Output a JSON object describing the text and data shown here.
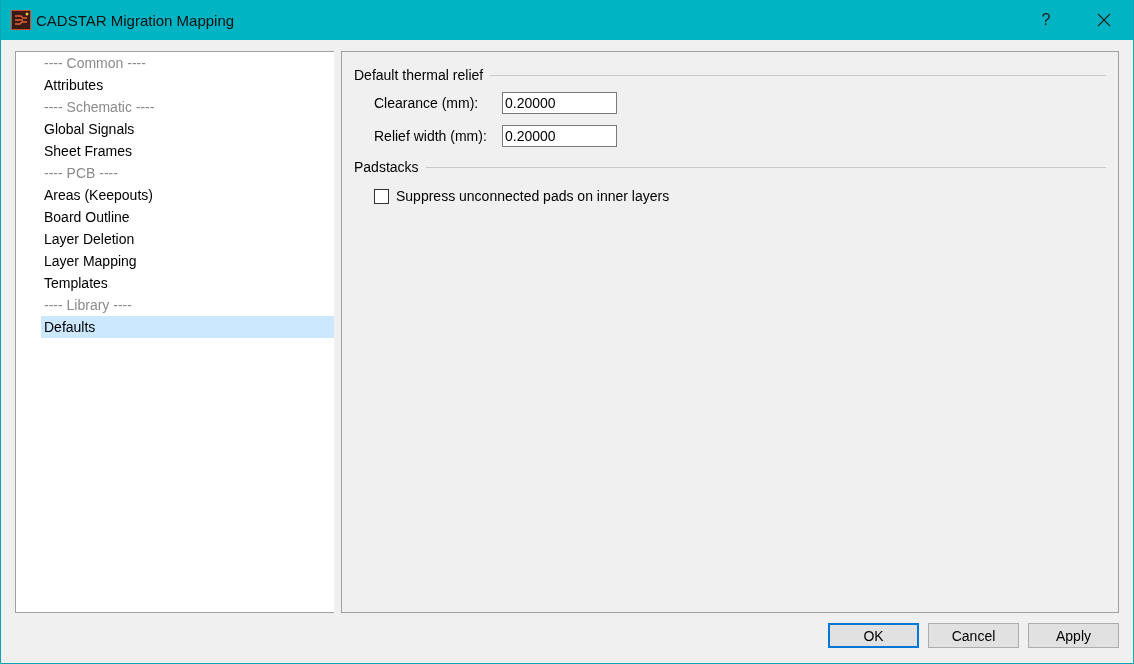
{
  "window": {
    "title": "CADSTAR Migration Mapping",
    "help": "?"
  },
  "sidebar": {
    "items": [
      {
        "kind": "header",
        "label": "---- Common ----",
        "selected": false
      },
      {
        "kind": "item",
        "label": "Attributes",
        "selected": false
      },
      {
        "kind": "header",
        "label": "---- Schematic ----",
        "selected": false
      },
      {
        "kind": "item",
        "label": "Global Signals",
        "selected": false
      },
      {
        "kind": "item",
        "label": "Sheet Frames",
        "selected": false
      },
      {
        "kind": "header",
        "label": "---- PCB ----",
        "selected": false
      },
      {
        "kind": "item",
        "label": "Areas (Keepouts)",
        "selected": false
      },
      {
        "kind": "item",
        "label": "Board Outline",
        "selected": false
      },
      {
        "kind": "item",
        "label": "Layer Deletion",
        "selected": false
      },
      {
        "kind": "item",
        "label": "Layer Mapping",
        "selected": false
      },
      {
        "kind": "item",
        "label": "Templates",
        "selected": false
      },
      {
        "kind": "header",
        "label": "---- Library ----",
        "selected": false
      },
      {
        "kind": "item",
        "label": "Defaults",
        "selected": true
      }
    ]
  },
  "panel": {
    "sections": [
      {
        "title": "Default thermal relief",
        "fields": [
          {
            "kind": "text",
            "label": "Clearance (mm):",
            "value": "0.20000"
          },
          {
            "kind": "text",
            "label": "Relief width (mm):",
            "value": "0.20000"
          }
        ]
      },
      {
        "title": "Padstacks",
        "fields": [
          {
            "kind": "checkbox",
            "label": "Suppress unconnected pads on inner layers",
            "checked": false
          }
        ]
      }
    ]
  },
  "buttons": [
    {
      "label": "OK",
      "default": true
    },
    {
      "label": "Cancel",
      "default": false
    },
    {
      "label": "Apply",
      "default": false
    }
  ]
}
